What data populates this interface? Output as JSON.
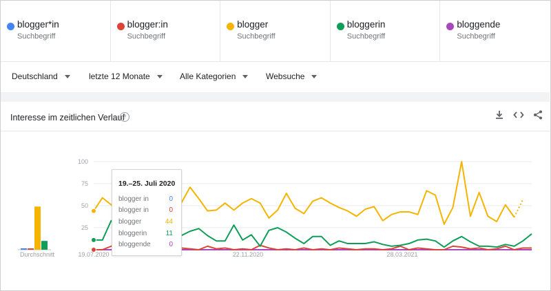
{
  "terms": [
    {
      "name": "blogger*in",
      "sub": "Suchbegriff",
      "color": "#4285f4"
    },
    {
      "name": "blogger:in",
      "sub": "Suchbegriff",
      "color": "#db4437"
    },
    {
      "name": "blogger",
      "sub": "Suchbegriff",
      "color": "#f4b400"
    },
    {
      "name": "bloggerin",
      "sub": "Suchbegriff",
      "color": "#0f9d58"
    },
    {
      "name": "bloggende",
      "sub": "Suchbegriff",
      "color": "#ab47bc"
    }
  ],
  "filters": {
    "region": "Deutschland",
    "time": "letzte 12 Monate",
    "category": "Alle Kategorien",
    "search_type": "Websuche"
  },
  "card": {
    "title": "Interesse im zeitlichen Verlauf",
    "help_glyph": "?",
    "download_icon": "download-icon",
    "embed_icon": "embed-icon",
    "share_icon": "share-icon"
  },
  "tooltip": {
    "title": "19.–25. Juli 2020",
    "rows": [
      {
        "label": "blogger in",
        "value": "0",
        "color": "#4285f4"
      },
      {
        "label": "blogger in",
        "value": "0",
        "color": "#db4437"
      },
      {
        "label": "blogger",
        "value": "44",
        "color": "#f4b400"
      },
      {
        "label": "bloggerin",
        "value": "11",
        "color": "#0f9d58"
      },
      {
        "label": "bloggende",
        "value": "0",
        "color": "#ab47bc"
      }
    ]
  },
  "chart_data": {
    "type": "line",
    "y_ticks": [
      "100",
      "75",
      "50",
      "25"
    ],
    "ylim": [
      0,
      100
    ],
    "x_ticks": [
      "19.07.2020",
      "22.11.2020",
      "28.03.2021"
    ],
    "average_label": "Durchschnitt",
    "averages": [
      {
        "name": "blogger*in",
        "value": 1,
        "color": "#4285f4"
      },
      {
        "name": "blogger:in",
        "value": 1,
        "color": "#db4437"
      },
      {
        "name": "blogger",
        "value": 49,
        "color": "#f4b400"
      },
      {
        "name": "bloggerin",
        "value": 10,
        "color": "#0f9d58"
      },
      {
        "name": "bloggende",
        "value": 0,
        "color": "#ab47bc"
      }
    ],
    "series": [
      {
        "name": "blogger",
        "color": "#f4b400",
        "values": [
          44,
          59,
          51,
          54,
          58,
          49,
          52,
          50,
          53,
          54,
          53,
          71,
          58,
          44,
          45,
          53,
          45,
          53,
          58,
          53,
          36,
          45,
          64,
          47,
          41,
          55,
          59,
          53,
          48,
          44,
          38,
          46,
          49,
          33,
          40,
          43,
          43,
          40,
          67,
          62,
          29,
          48,
          100,
          38,
          65,
          38,
          32,
          51,
          37,
          57
        ]
      },
      {
        "name": "bloggerin",
        "color": "#0f9d58",
        "values": [
          11,
          11,
          33,
          18,
          20,
          14,
          12,
          15,
          7,
          12,
          16,
          21,
          24,
          16,
          10,
          10,
          28,
          11,
          17,
          4,
          22,
          25,
          20,
          13,
          7,
          15,
          15,
          5,
          10,
          7,
          7,
          7,
          9,
          6,
          4,
          5,
          7,
          11,
          12,
          10,
          3,
          10,
          15,
          9,
          4,
          4,
          3,
          6,
          4,
          10,
          18
        ]
      },
      {
        "name": "blogger:in",
        "color": "#db4437",
        "values": [
          0,
          0,
          4,
          1,
          0,
          1,
          2,
          0,
          1,
          0,
          2,
          1,
          0,
          4,
          1,
          2,
          0,
          1,
          0,
          5,
          2,
          0,
          1,
          0,
          2,
          0,
          1,
          0,
          2,
          1,
          0,
          1,
          1,
          0,
          1,
          4,
          0,
          2,
          1,
          0,
          0,
          4,
          3,
          1,
          2,
          0,
          1,
          4,
          0,
          2,
          2
        ]
      },
      {
        "name": "blogger*in",
        "color": "#4285f4",
        "values": [
          0,
          0,
          0,
          0,
          0,
          0,
          0,
          0,
          0,
          0,
          0,
          0,
          0,
          0,
          0,
          0,
          0,
          0,
          0,
          0,
          0,
          0,
          0,
          0,
          0,
          0,
          0,
          0,
          0,
          0,
          0,
          0,
          0,
          0,
          0,
          0,
          0,
          0,
          0,
          0,
          0,
          0,
          0,
          0,
          0,
          0,
          0,
          0,
          0,
          0,
          0
        ]
      },
      {
        "name": "bloggende",
        "color": "#ab47bc",
        "values": [
          0,
          0,
          0,
          0,
          0,
          0,
          0,
          0,
          0,
          0,
          0,
          0,
          0,
          0,
          0,
          0,
          0,
          0,
          0,
          0,
          0,
          0,
          0,
          0,
          0,
          0,
          0,
          0,
          0,
          0,
          0,
          0,
          0,
          0,
          0,
          0,
          0,
          0,
          0,
          0,
          0,
          0,
          0,
          0,
          0,
          0,
          0,
          0,
          0,
          0,
          0
        ]
      }
    ]
  }
}
